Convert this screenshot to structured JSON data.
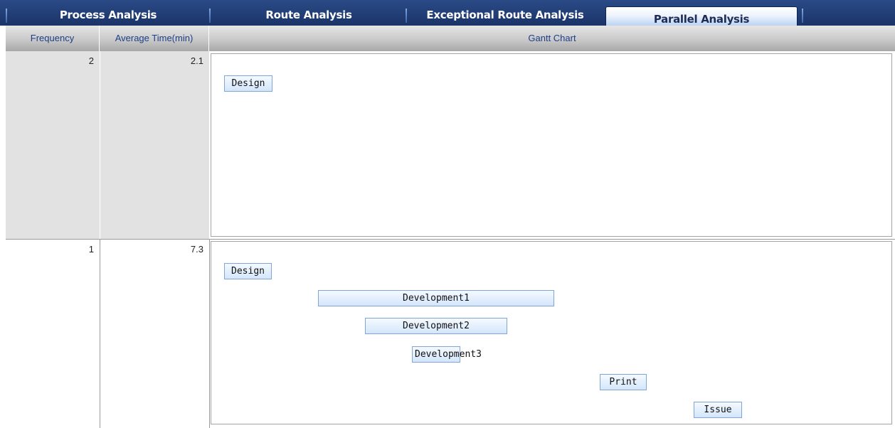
{
  "tabs": {
    "process": "Process Analysis",
    "route": "Route Analysis",
    "exceptional": "Exceptional Route Analysis",
    "parallel": "Parallel Analysis"
  },
  "columns": {
    "frequency": "Frequency",
    "average_time": "Average Time(min)",
    "gantt": "Gantt Chart"
  },
  "rows": [
    {
      "frequency": "2",
      "average_time": "2.1",
      "tasks": [
        "Design"
      ]
    },
    {
      "frequency": "1",
      "average_time": "7.3",
      "tasks": [
        "Design",
        "Development1",
        "Development2",
        "Development3",
        "Print",
        "Issue"
      ]
    }
  ],
  "colors": {
    "tab_bar": "#1b3469",
    "column_header_text": "#1c3f86",
    "task_bar_border": "#7fa5d9"
  }
}
